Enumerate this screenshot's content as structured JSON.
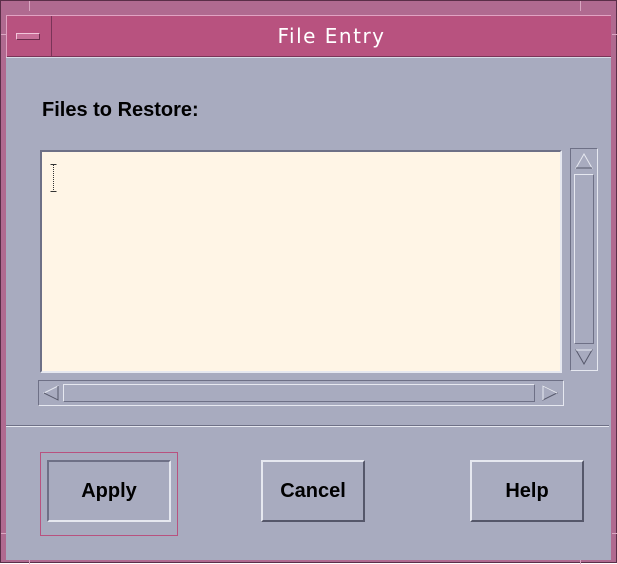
{
  "window": {
    "title": "File Entry",
    "accent_color": "#b8527f",
    "body_color": "#a8abbf"
  },
  "icons": {
    "window_menu": "window-menu-icon",
    "text_cursor": "i-beam-cursor-icon",
    "scroll_up": "arrow-up-icon",
    "scroll_down": "arrow-down-icon",
    "scroll_left": "arrow-left-icon",
    "scroll_right": "arrow-right-icon"
  },
  "form": {
    "label": "Files to Restore:",
    "textarea_value": ""
  },
  "buttons": {
    "apply": "Apply",
    "cancel": "Cancel",
    "help": "Help",
    "default": "apply"
  }
}
